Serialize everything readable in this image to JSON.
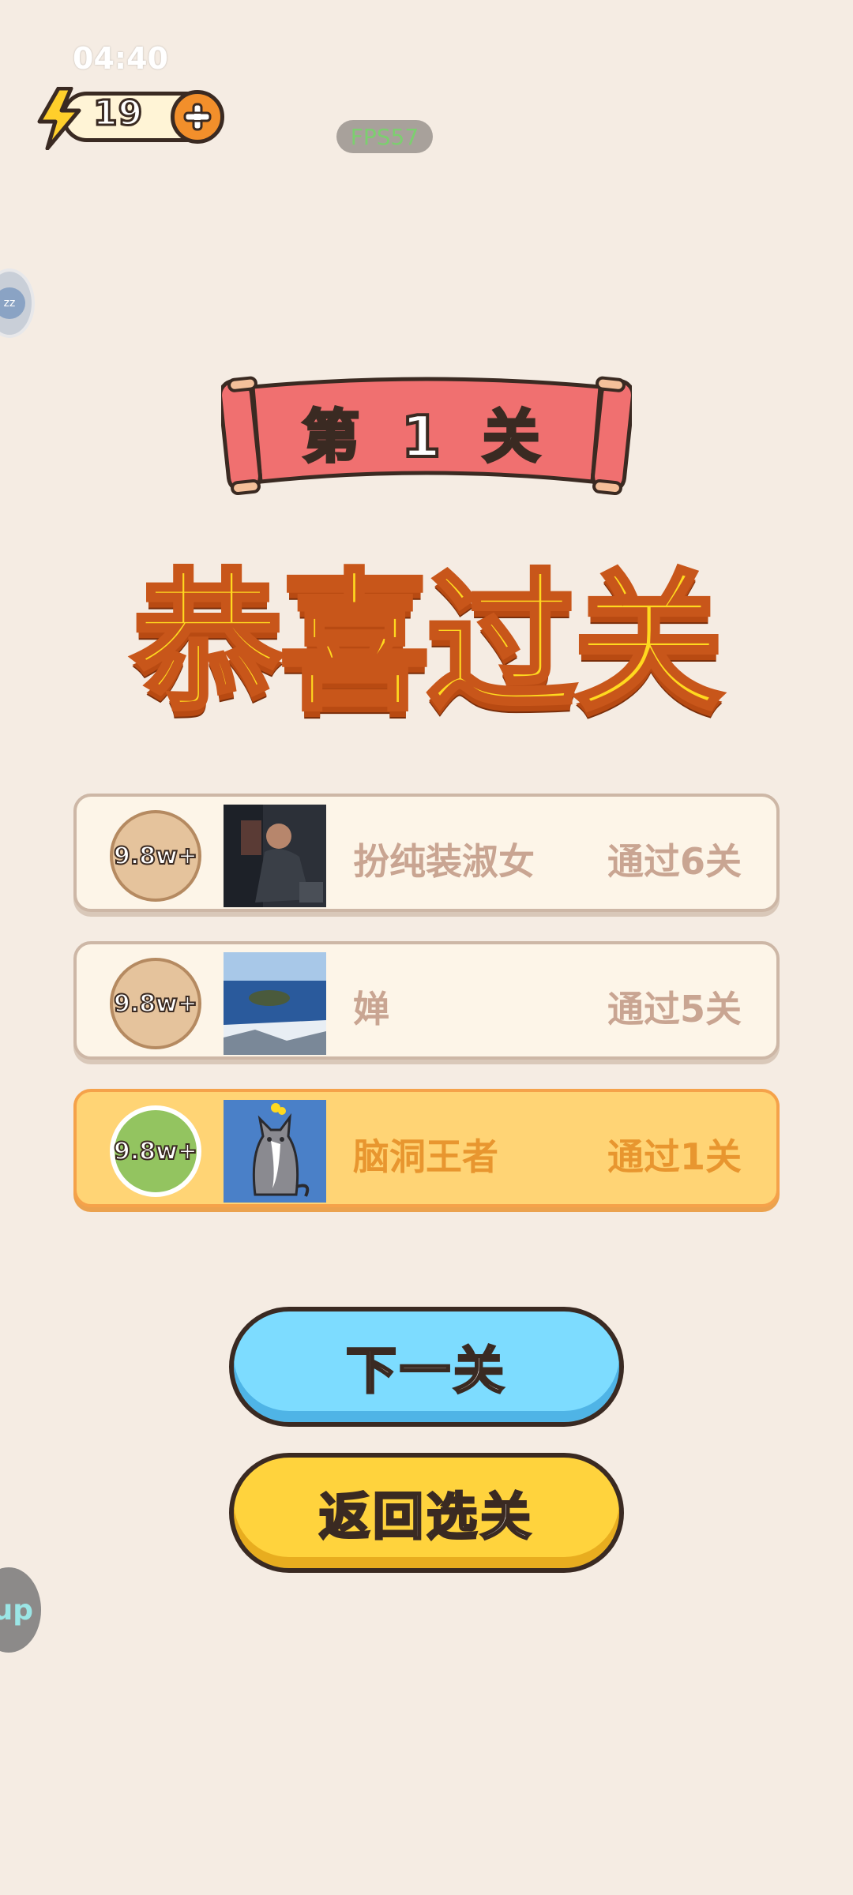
{
  "status_bar": {
    "time": "04:40"
  },
  "energy": {
    "value": "19"
  },
  "debug": {
    "fps": "FPS57"
  },
  "floating": {
    "left_top_label": "zz",
    "left_bottom_label": "up"
  },
  "level": {
    "label": "第 1 关"
  },
  "headline": "恭喜过关",
  "leaderboard": [
    {
      "rank_label": "9.8w+",
      "name": "扮纯装淑女",
      "progress": "通过6关",
      "avatar": "person-photo",
      "highlight": false
    },
    {
      "rank_label": "9.8w+",
      "name": "婵",
      "progress": "通过5关",
      "avatar": "lake-photo",
      "highlight": false
    },
    {
      "rank_label": "9.8w+",
      "name": "脑洞王者",
      "progress": "通过1关",
      "avatar": "cat-avatar",
      "highlight": true
    }
  ],
  "buttons": {
    "next": "下一关",
    "back": "返回选关"
  },
  "colors": {
    "background": "#f5ece3",
    "ribbon": "#f07070",
    "headline_fill": "#ffd91f",
    "next_button": "#7ddcff",
    "back_button": "#ffd33d",
    "highlight_row": "#ffd475"
  }
}
